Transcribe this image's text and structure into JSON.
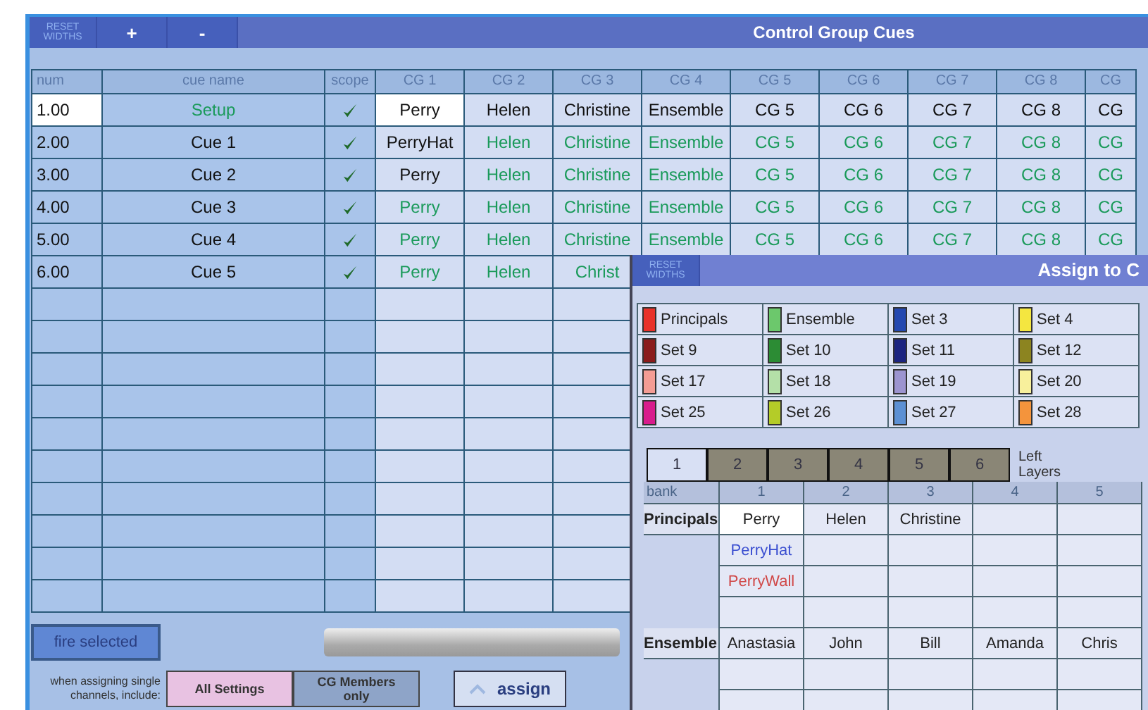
{
  "window": {
    "title": "Control Group Cues",
    "toolbar": [
      "RESET WIDTHS",
      "+",
      "-"
    ]
  },
  "table": {
    "columns": [
      "num",
      "cue name",
      "scope",
      "CG 1",
      "CG 2",
      "CG 3",
      "CG 4",
      "CG 5",
      "CG 6",
      "CG 7",
      "CG 8",
      "CG"
    ],
    "rows": [
      {
        "num": "1.00",
        "num_selected": true,
        "name": "Setup",
        "name_tracked": true,
        "scope": true,
        "groups": [
          {
            "text": "Perry",
            "tracked": false,
            "selected": true
          },
          {
            "text": "Helen",
            "tracked": false,
            "selected": false
          },
          {
            "text": "Christine",
            "tracked": false,
            "selected": false
          },
          {
            "text": "Ensemble",
            "tracked": false,
            "selected": false
          },
          {
            "text": "CG 5",
            "tracked": false,
            "selected": false
          },
          {
            "text": "CG 6",
            "tracked": false,
            "selected": false
          },
          {
            "text": "CG 7",
            "tracked": false,
            "selected": false
          },
          {
            "text": "CG 8",
            "tracked": false,
            "selected": false
          },
          {
            "text": "CG",
            "tracked": false,
            "selected": false
          }
        ]
      },
      {
        "num": "2.00",
        "num_selected": false,
        "name": "Cue 1",
        "name_tracked": false,
        "scope": true,
        "groups": [
          {
            "text": "PerryHat",
            "tracked": false,
            "selected": false
          },
          {
            "text": "Helen",
            "tracked": true,
            "selected": false
          },
          {
            "text": "Christine",
            "tracked": true,
            "selected": false
          },
          {
            "text": "Ensemble",
            "tracked": true,
            "selected": false
          },
          {
            "text": "CG 5",
            "tracked": true,
            "selected": false
          },
          {
            "text": "CG 6",
            "tracked": true,
            "selected": false
          },
          {
            "text": "CG 7",
            "tracked": true,
            "selected": false
          },
          {
            "text": "CG 8",
            "tracked": true,
            "selected": false
          },
          {
            "text": "CG",
            "tracked": true,
            "selected": false
          }
        ]
      },
      {
        "num": "3.00",
        "num_selected": false,
        "name": "Cue 2",
        "name_tracked": false,
        "scope": true,
        "groups": [
          {
            "text": "Perry",
            "tracked": false,
            "selected": false
          },
          {
            "text": "Helen",
            "tracked": true,
            "selected": false
          },
          {
            "text": "Christine",
            "tracked": true,
            "selected": false
          },
          {
            "text": "Ensemble",
            "tracked": true,
            "selected": false
          },
          {
            "text": "CG 5",
            "tracked": true,
            "selected": false
          },
          {
            "text": "CG 6",
            "tracked": true,
            "selected": false
          },
          {
            "text": "CG 7",
            "tracked": true,
            "selected": false
          },
          {
            "text": "CG 8",
            "tracked": true,
            "selected": false
          },
          {
            "text": "CG",
            "tracked": true,
            "selected": false
          }
        ]
      },
      {
        "num": "4.00",
        "num_selected": false,
        "name": "Cue 3",
        "name_tracked": false,
        "scope": true,
        "groups": [
          {
            "text": "Perry",
            "tracked": true,
            "selected": false
          },
          {
            "text": "Helen",
            "tracked": true,
            "selected": false
          },
          {
            "text": "Christine",
            "tracked": true,
            "selected": false
          },
          {
            "text": "Ensemble",
            "tracked": true,
            "selected": false
          },
          {
            "text": "CG 5",
            "tracked": true,
            "selected": false
          },
          {
            "text": "CG 6",
            "tracked": true,
            "selected": false
          },
          {
            "text": "CG 7",
            "tracked": true,
            "selected": false
          },
          {
            "text": "CG 8",
            "tracked": true,
            "selected": false
          },
          {
            "text": "CG",
            "tracked": true,
            "selected": false
          }
        ]
      },
      {
        "num": "5.00",
        "num_selected": false,
        "name": "Cue 4",
        "name_tracked": false,
        "scope": true,
        "groups": [
          {
            "text": "Perry",
            "tracked": true,
            "selected": false
          },
          {
            "text": "Helen",
            "tracked": true,
            "selected": false
          },
          {
            "text": "Christine",
            "tracked": true,
            "selected": false
          },
          {
            "text": "Ensemble",
            "tracked": true,
            "selected": false
          },
          {
            "text": "CG 5",
            "tracked": true,
            "selected": false
          },
          {
            "text": "CG 6",
            "tracked": true,
            "selected": false
          },
          {
            "text": "CG 7",
            "tracked": true,
            "selected": false
          },
          {
            "text": "CG 8",
            "tracked": true,
            "selected": false
          },
          {
            "text": "CG",
            "tracked": true,
            "selected": false
          }
        ]
      },
      {
        "num": "6.00",
        "num_selected": false,
        "name": "Cue 5",
        "name_tracked": false,
        "scope": true,
        "groups": [
          {
            "text": "Perry",
            "tracked": true,
            "selected": false
          },
          {
            "text": "Helen",
            "tracked": true,
            "selected": false
          },
          {
            "text": "Christ",
            "tracked": true,
            "selected": false
          }
        ]
      }
    ]
  },
  "fire_button": "fire selected",
  "assign_options": {
    "label": "when assigning single channels, include:",
    "options": [
      {
        "label": "All Settings",
        "selected": true
      },
      {
        "label": "CG Members only",
        "selected": false
      }
    ]
  },
  "assign_button": "assign",
  "dialog": {
    "title": "Assign to C",
    "reset_button": "RESET WIDTHS",
    "sets": [
      {
        "name": "Principals",
        "color": "#e8322a"
      },
      {
        "name": "Ensemble",
        "color": "#6cc86c"
      },
      {
        "name": "Set 3",
        "color": "#2448b0"
      },
      {
        "name": "Set 4",
        "color": "#f4e640"
      },
      {
        "name": "Set 9",
        "color": "#8a1c1c"
      },
      {
        "name": "Set 10",
        "color": "#2c8c34"
      },
      {
        "name": "Set 11",
        "color": "#1c2480"
      },
      {
        "name": "Set 12",
        "color": "#8c8420"
      },
      {
        "name": "Set 17",
        "color": "#f49c94"
      },
      {
        "name": "Set 18",
        "color": "#b4e0a8"
      },
      {
        "name": "Set 19",
        "color": "#9c94d0"
      },
      {
        "name": "Set 20",
        "color": "#f8f09c"
      },
      {
        "name": "Set 25",
        "color": "#d81c8c"
      },
      {
        "name": "Set 26",
        "color": "#b4cc28"
      },
      {
        "name": "Set 27",
        "color": "#5c90d4"
      },
      {
        "name": "Set 28",
        "color": "#f4943c"
      }
    ],
    "layer_tabs": [
      {
        "label": "1",
        "selected": true
      },
      {
        "label": "2",
        "selected": false
      },
      {
        "label": "3",
        "selected": false
      },
      {
        "label": "4",
        "selected": false
      },
      {
        "label": "5",
        "selected": false
      },
      {
        "label": "6",
        "selected": false
      }
    ],
    "layer_label": "Left Layers",
    "bank": {
      "columns": [
        "bank",
        "1",
        "2",
        "3",
        "4",
        "5"
      ],
      "groups": [
        {
          "name": "Principals",
          "rows": [
            [
              {
                "text": "Perry",
                "color": "#222222",
                "selected": true
              },
              {
                "text": "Helen",
                "color": "#222222",
                "selected": false
              },
              {
                "text": "Christine",
                "color": "#222222",
                "selected": false
              }
            ],
            [
              {
                "text": "PerryHat",
                "color": "#3a4ed0",
                "selected": false
              }
            ],
            [
              {
                "text": "PerryWall",
                "color": "#d04848",
                "selected": false
              }
            ]
          ]
        },
        {
          "name": "Ensemble",
          "rows": [
            [
              {
                "text": "Anastasia",
                "color": "#222222",
                "selected": false
              },
              {
                "text": "John",
                "color": "#222222",
                "selected": false
              },
              {
                "text": "Bill",
                "color": "#222222",
                "selected": false
              },
              {
                "text": "Amanda",
                "color": "#222222",
                "selected": false
              },
              {
                "text": "Chris",
                "color": "#222222",
                "selected": false
              }
            ]
          ]
        }
      ]
    }
  }
}
